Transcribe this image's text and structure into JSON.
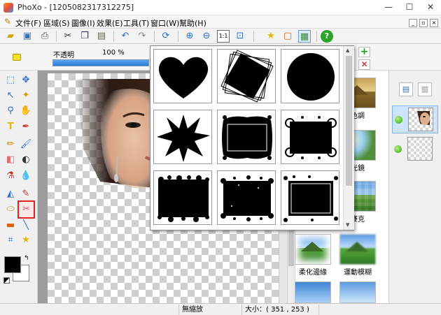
{
  "window": {
    "title": "PhoXo - [1205082317312275]",
    "minimize": "—",
    "maximize": "☐",
    "close": "✕"
  },
  "menu": [
    "文件(F)",
    "區域(S)",
    "圖像(I)",
    "效果(E)",
    "工具(T)",
    "窗口(W)",
    "幫助(H)"
  ],
  "options": {
    "opacity_label": "不透明",
    "opacity_value": "100 %",
    "opacity_fraction": 1.0
  },
  "effects": [
    {
      "label": "色調"
    },
    {
      "label": "光鏡"
    },
    {
      "label": "賽克"
    },
    {
      "label": "柔化邊緣"
    },
    {
      "label": "運動模糊"
    },
    {
      "label": ""
    },
    {
      "label": ""
    }
  ],
  "status": {
    "left": "無縮放",
    "size": "大小：( 351 , 253 )"
  },
  "colors": {
    "accent": "#2c7cd8",
    "selection_red": "#e02424"
  }
}
